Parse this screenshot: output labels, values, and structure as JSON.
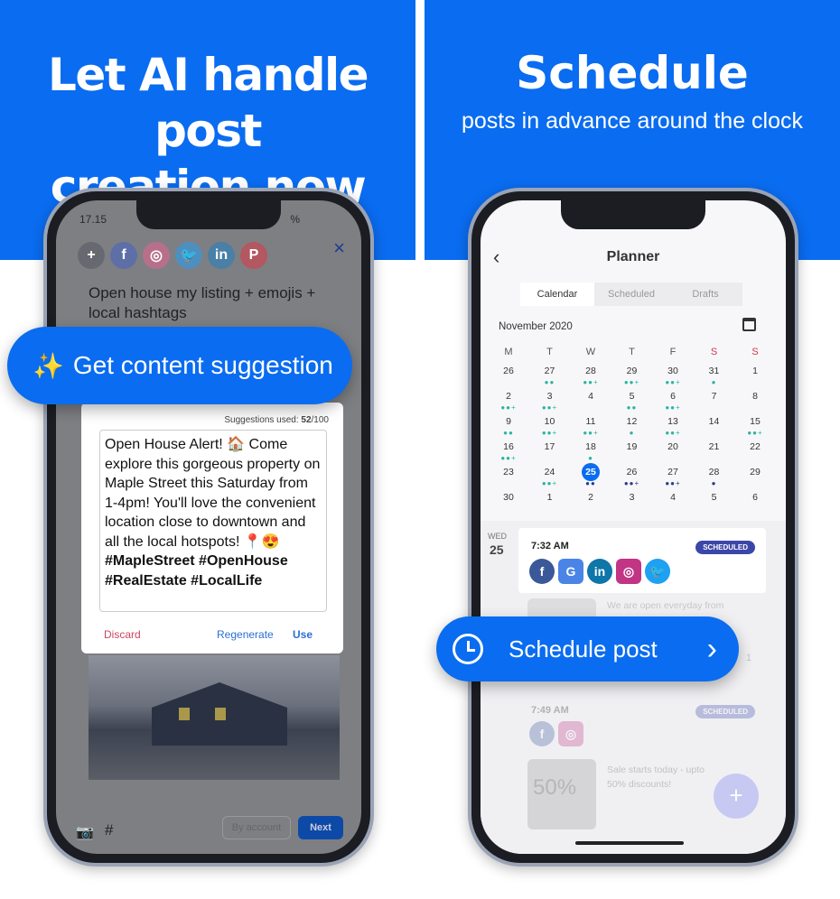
{
  "left": {
    "headline": [
      "Let AI handle post",
      "creation now"
    ],
    "status_time": "17.15",
    "status_right": "%",
    "social_icons": [
      {
        "name": "add",
        "glyph": "+",
        "color": "#666a70"
      },
      {
        "name": "facebook",
        "glyph": "f",
        "color": "#5e6fa8"
      },
      {
        "name": "instagram",
        "glyph": "◎",
        "color": "#b8708a"
      },
      {
        "name": "twitter",
        "glyph": "🐦",
        "color": "#4e8fbf"
      },
      {
        "name": "linkedin",
        "glyph": "in",
        "color": "#4a7fa6"
      },
      {
        "name": "pinterest",
        "glyph": "P",
        "color": "#b35760"
      }
    ],
    "close_glyph": "×",
    "prompt": "Open house my listing + emojis + local hashtags",
    "pill_label": "Get content suggestion",
    "suggestions_label": "Suggestions used: ",
    "suggestions_used": "52",
    "suggestions_total": "/100",
    "generated_text": "Open House Alert! 🏠 Come explore this gorgeous property on Maple Street this Saturday from 1-4pm! You'll love the convenient location close to downtown and all the local hotspots! 📍😍",
    "generated_hashtags": "#MapleStreet #OpenHouse #RealEstate #LocalLife",
    "discard": "Discard",
    "regenerate": "Regenerate",
    "use": "Use",
    "by_account": "By account",
    "next": "Next"
  },
  "right": {
    "headline": "Schedule",
    "subheadline": "posts in advance around the clock",
    "title": "Planner",
    "tabs": [
      "Calendar",
      "Scheduled",
      "Drafts"
    ],
    "active_tab": 0,
    "month": "November 2020",
    "weekdays": [
      "M",
      "T",
      "W",
      "T",
      "F",
      "S",
      "S"
    ],
    "weeks": [
      [
        [
          "26",
          0
        ],
        [
          "27",
          2
        ],
        [
          "28",
          3
        ],
        [
          "29",
          3
        ],
        [
          "30",
          3
        ],
        [
          "31",
          1
        ],
        [
          "1",
          0
        ]
      ],
      [
        [
          "2",
          3
        ],
        [
          "3",
          3
        ],
        [
          "4",
          0
        ],
        [
          "5",
          2
        ],
        [
          "6",
          3
        ],
        [
          "7",
          0
        ],
        [
          "8",
          0
        ]
      ],
      [
        [
          "9",
          2
        ],
        [
          "10",
          3
        ],
        [
          "11",
          3
        ],
        [
          "12",
          1
        ],
        [
          "13",
          3
        ],
        [
          "14",
          0
        ],
        [
          "15",
          3
        ]
      ],
      [
        [
          "16",
          3
        ],
        [
          "17",
          0
        ],
        [
          "18",
          1
        ],
        [
          "19",
          0
        ],
        [
          "20",
          0
        ],
        [
          "21",
          0
        ],
        [
          "22",
          0
        ]
      ],
      [
        [
          "23",
          0
        ],
        [
          "24",
          3
        ],
        [
          "25",
          2
        ],
        [
          "26",
          3
        ],
        [
          "27",
          3
        ],
        [
          "28",
          1
        ],
        [
          "29",
          0
        ]
      ],
      [
        [
          "30",
          0
        ],
        [
          "1",
          0
        ],
        [
          "2",
          0
        ],
        [
          "3",
          0
        ],
        [
          "4",
          0
        ],
        [
          "5",
          0
        ],
        [
          "6",
          0
        ]
      ]
    ],
    "selected_day": "25",
    "colors": {
      "accent": "#0a6cf0",
      "dot_past": "#2bb5a0",
      "dot_future": "#2b3a8a",
      "weekend": "#d0394f",
      "badge": "#3b47a8"
    },
    "day_label": "WED",
    "day_num": "25",
    "posts": [
      {
        "time": "7:32 AM",
        "status": "SCHEDULED",
        "networks": [
          "facebook",
          "google-business",
          "linkedin",
          "instagram",
          "twitter"
        ],
        "text": "We are open everyday from",
        "count": "1"
      },
      {
        "time": "7:49 AM",
        "status": "SCHEDULED",
        "networks": [
          "facebook",
          "instagram"
        ],
        "text": "Sale starts today - upto 50% discounts!",
        "image_text": "50%"
      }
    ],
    "pill_label": "Schedule post",
    "fab": "+"
  }
}
